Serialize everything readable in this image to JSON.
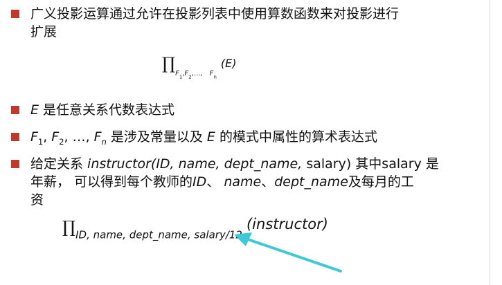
{
  "bullets": [
    {
      "line1": "广义投影运算通过允许在投影列表中使用算数函数来对投影进行",
      "line2": "扩展"
    },
    {
      "e": "E",
      "text": " 是任意关系代数表达式"
    },
    {
      "f": "F",
      "s1": "1",
      "s2": "2",
      "sn": "n",
      "sep": ", ",
      "ellipsis": "…",
      "text_a": " 是涉及常量以及 ",
      "e": "E",
      "text_b": " 的模式中属性的算术表达式"
    },
    {
      "a": "给定关系 ",
      "b": "instructor(ID, name, dept_name,",
      "c": " salary) 其中salary 是",
      "d": "年薪， 可以得到每个教师的",
      "e": "ID",
      "f": "、 ",
      "g": "name",
      "h": "、",
      "i": "dept_name",
      "j": "及每月的工",
      "k": "资"
    }
  ],
  "formula1": {
    "pi": "∏",
    "f1": "F",
    "s1": "1",
    "comma": ",",
    "f2": "F",
    "s2": "2",
    "dots": ",...,",
    "fn": "F",
    "sn": "n",
    "arg": "(E)"
  },
  "formula2": {
    "pi": "∏",
    "subscript": "ID, name, dept_name, salary/12",
    "arg": "(instructor)"
  },
  "colors": {
    "bullet": "#c0392b",
    "arrow": "#3ec9d6"
  }
}
